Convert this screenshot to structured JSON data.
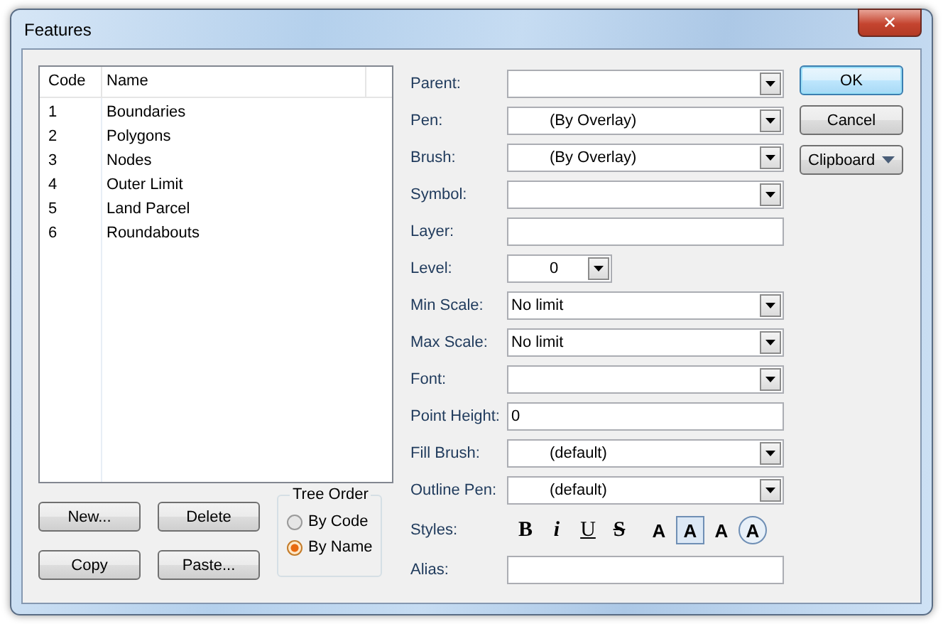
{
  "window": {
    "title": "Features",
    "close": "✕"
  },
  "table": {
    "columns": [
      "Code",
      "Name"
    ],
    "rows": [
      {
        "code": "1",
        "name": "Boundaries"
      },
      {
        "code": "2",
        "name": "Polygons"
      },
      {
        "code": "3",
        "name": "Nodes"
      },
      {
        "code": "4",
        "name": "Outer Limit"
      },
      {
        "code": "5",
        "name": "Land Parcel"
      },
      {
        "code": "6",
        "name": "Roundabouts"
      }
    ]
  },
  "list_buttons": [
    "New...",
    "Delete",
    "Copy",
    "Paste..."
  ],
  "tree_order": {
    "title": "Tree Order",
    "options": [
      {
        "label": "By Code",
        "selected": false
      },
      {
        "label": "By Name",
        "selected": true
      }
    ]
  },
  "fields": [
    {
      "label": "Parent:",
      "kind": "combo"
    },
    {
      "label": "Pen:",
      "kind": "swatch-combo",
      "value": "(By Overlay)"
    },
    {
      "label": "Brush:",
      "kind": "swatch-combo",
      "value": "(By Overlay)"
    },
    {
      "label": "Symbol:",
      "kind": "combo"
    },
    {
      "label": "Layer:",
      "kind": "text"
    },
    {
      "label": "Level:",
      "kind": "short-combo",
      "value": "0"
    },
    {
      "label": "Min Scale:",
      "kind": "combo",
      "value": "No limit"
    },
    {
      "label": "Max Scale:",
      "kind": "combo",
      "value": "No limit"
    },
    {
      "label": "Font:",
      "kind": "combo"
    },
    {
      "label": "Point Height:",
      "kind": "text",
      "value": "0"
    },
    {
      "label": "Fill Brush:",
      "kind": "swatch-combo",
      "value": "(default)"
    },
    {
      "label": "Outline Pen:",
      "kind": "swatch-combo",
      "value": "(default)"
    },
    {
      "label": "Styles:",
      "kind": "styles"
    },
    {
      "label": "Alias:",
      "kind": "text"
    }
  ],
  "styles": [
    {
      "label": "B",
      "kind": "bold"
    },
    {
      "label": "i",
      "kind": "italic"
    },
    {
      "label": "U",
      "kind": "underline"
    },
    {
      "label": "S",
      "kind": "strike"
    },
    {
      "label": "A",
      "kind": "solid"
    },
    {
      "label": "A",
      "kind": "boxed"
    },
    {
      "label": "A",
      "kind": "solid"
    },
    {
      "label": "A",
      "kind": "ringed"
    }
  ],
  "action_buttons": [
    {
      "label": "OK",
      "kind": "default"
    },
    {
      "label": "Cancel",
      "kind": "plain"
    },
    {
      "label": "Clipboard",
      "kind": "menu"
    }
  ]
}
